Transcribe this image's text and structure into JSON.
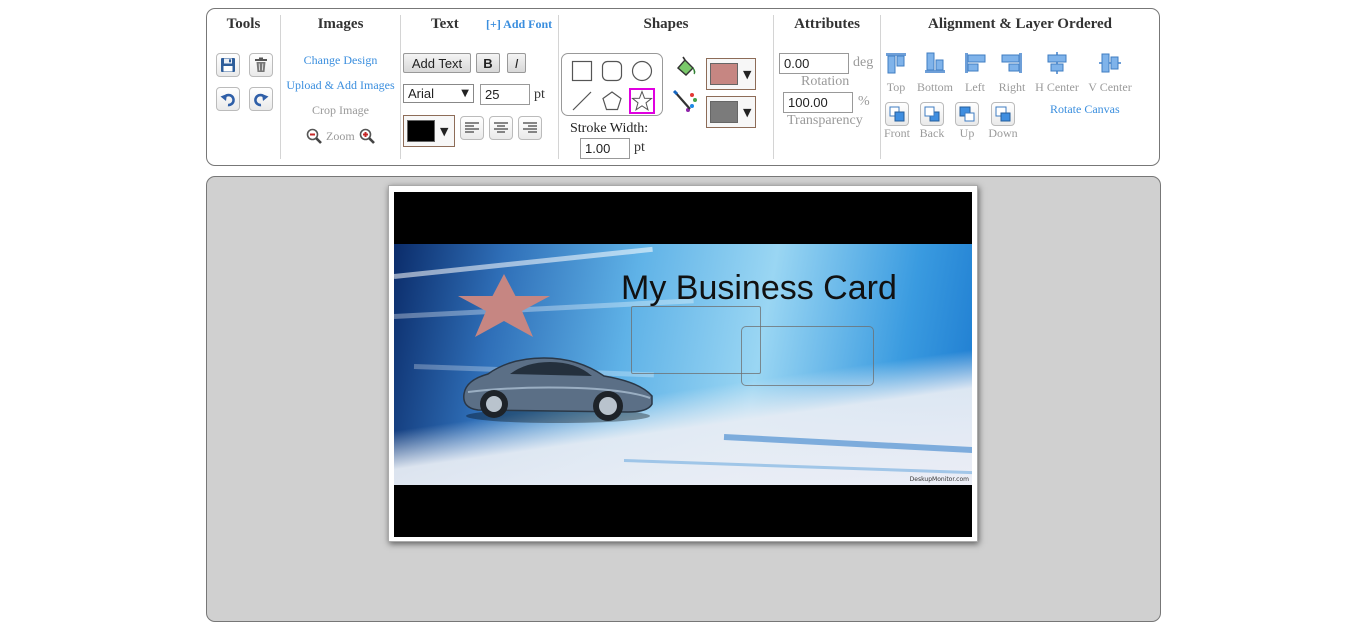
{
  "toolbar": {
    "tools": {
      "title": "Tools",
      "save_icon": "floppy-disk-icon",
      "delete_icon": "trash-can-icon",
      "undo_icon": "undo-arrow-icon",
      "redo_icon": "redo-arrow-icon"
    },
    "images": {
      "title": "Images",
      "change_design": "Change Design",
      "upload_add": "Upload & Add Images",
      "crop": "Crop Image",
      "zoom": "Zoom"
    },
    "text": {
      "title": "Text",
      "add_font": "[+] Add Font",
      "add_text": "Add Text",
      "bold": "B",
      "italic": "I",
      "font_family": "Arial",
      "font_size": "25",
      "font_size_unit": "pt",
      "text_color": "#000000"
    },
    "shapes": {
      "title": "Shapes",
      "stroke_width_label": "Stroke Width:",
      "stroke_width": "1.00",
      "stroke_unit": "pt",
      "fill_color": "#c68682",
      "stroke_color": "#7b7b7b",
      "selected_shape": "star"
    },
    "attributes": {
      "title": "Attributes",
      "rotation_value": "0.00",
      "rotation_unit": "deg",
      "rotation_label": "Rotation",
      "transparency_value": "100.00",
      "transparency_unit": "%",
      "transparency_label": "Transparency"
    },
    "alignment": {
      "title": "Alignment & Layer Ordered",
      "top": "Top",
      "bottom": "Bottom",
      "left": "Left",
      "right": "Right",
      "h_center": "H Center",
      "v_center": "V Center",
      "front": "Front",
      "back": "Back",
      "up": "Up",
      "down": "Down",
      "rotate_canvas": "Rotate Canvas"
    }
  },
  "canvas": {
    "title": "My Business Card",
    "watermark": "DeskupMonitor.com",
    "star_color": "#c68682"
  }
}
